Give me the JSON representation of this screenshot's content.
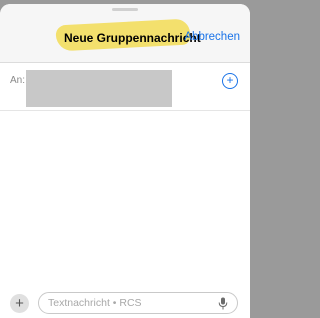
{
  "header": {
    "title": "Neue Gruppennachricht",
    "cancel_label": "Abbrechen"
  },
  "recipients": {
    "label": "An:"
  },
  "composer": {
    "placeholder": "Textnachricht • RCS",
    "add_button_glyph": "+",
    "add_contact_glyph": "+"
  },
  "colors": {
    "accent": "#1a73e8",
    "highlight": "#f2dc55",
    "redaction": "#c8c8c8"
  },
  "icons": [
    "plus-icon",
    "add-contact-icon",
    "microphone-icon"
  ]
}
